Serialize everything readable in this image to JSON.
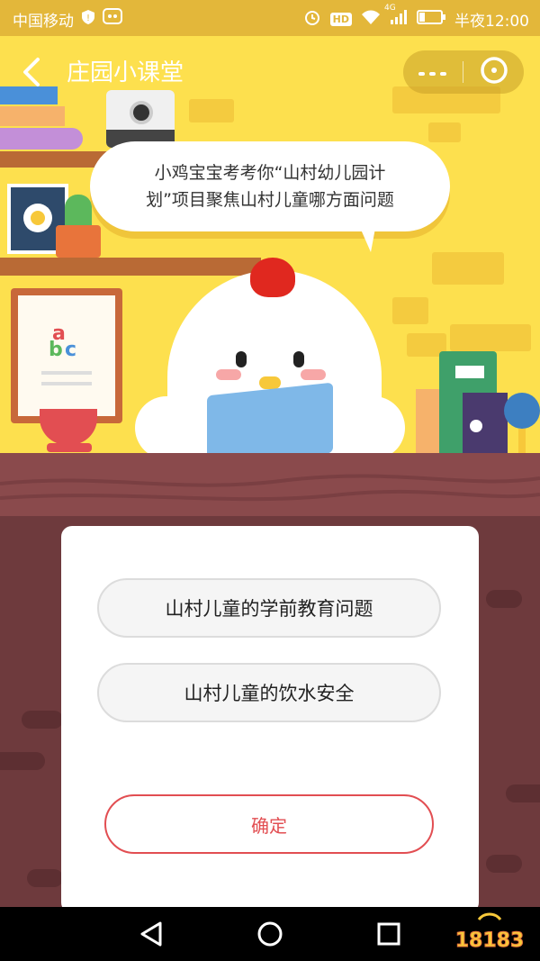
{
  "status_bar": {
    "carrier": "中国移动",
    "time": "半夜12:00",
    "network_label": "4G",
    "hd_label": "HD",
    "icons": [
      "shield-icon",
      "chat-icon",
      "alarm-icon",
      "hd-icon",
      "wifi-icon",
      "signal-icon",
      "battery-icon"
    ]
  },
  "header": {
    "title": "庄园小课堂",
    "back_icon": "chevron-left-icon",
    "more_icon": "more-icon",
    "close_icon": "close-circle-icon"
  },
  "question": {
    "line1": "小鸡宝宝考考你“山村幼儿园计",
    "line2": "划”项目聚焦山村儿童哪方面问题"
  },
  "decor": {
    "abc_a": "a",
    "abc_b": "b",
    "abc_c": "c"
  },
  "options": [
    {
      "label": "山村儿童的学前教育问题"
    },
    {
      "label": "山村儿童的饮水安全"
    }
  ],
  "confirm_label": "确定",
  "navbar": {
    "icons": [
      "back-triangle-icon",
      "home-circle-icon",
      "recents-square-icon"
    ],
    "watermark": "18183"
  },
  "colors": {
    "scene_bg": "#fde04e",
    "table": "#8a4a4c",
    "wood": "#6e3a3d",
    "confirm_accent": "#e24e52"
  }
}
